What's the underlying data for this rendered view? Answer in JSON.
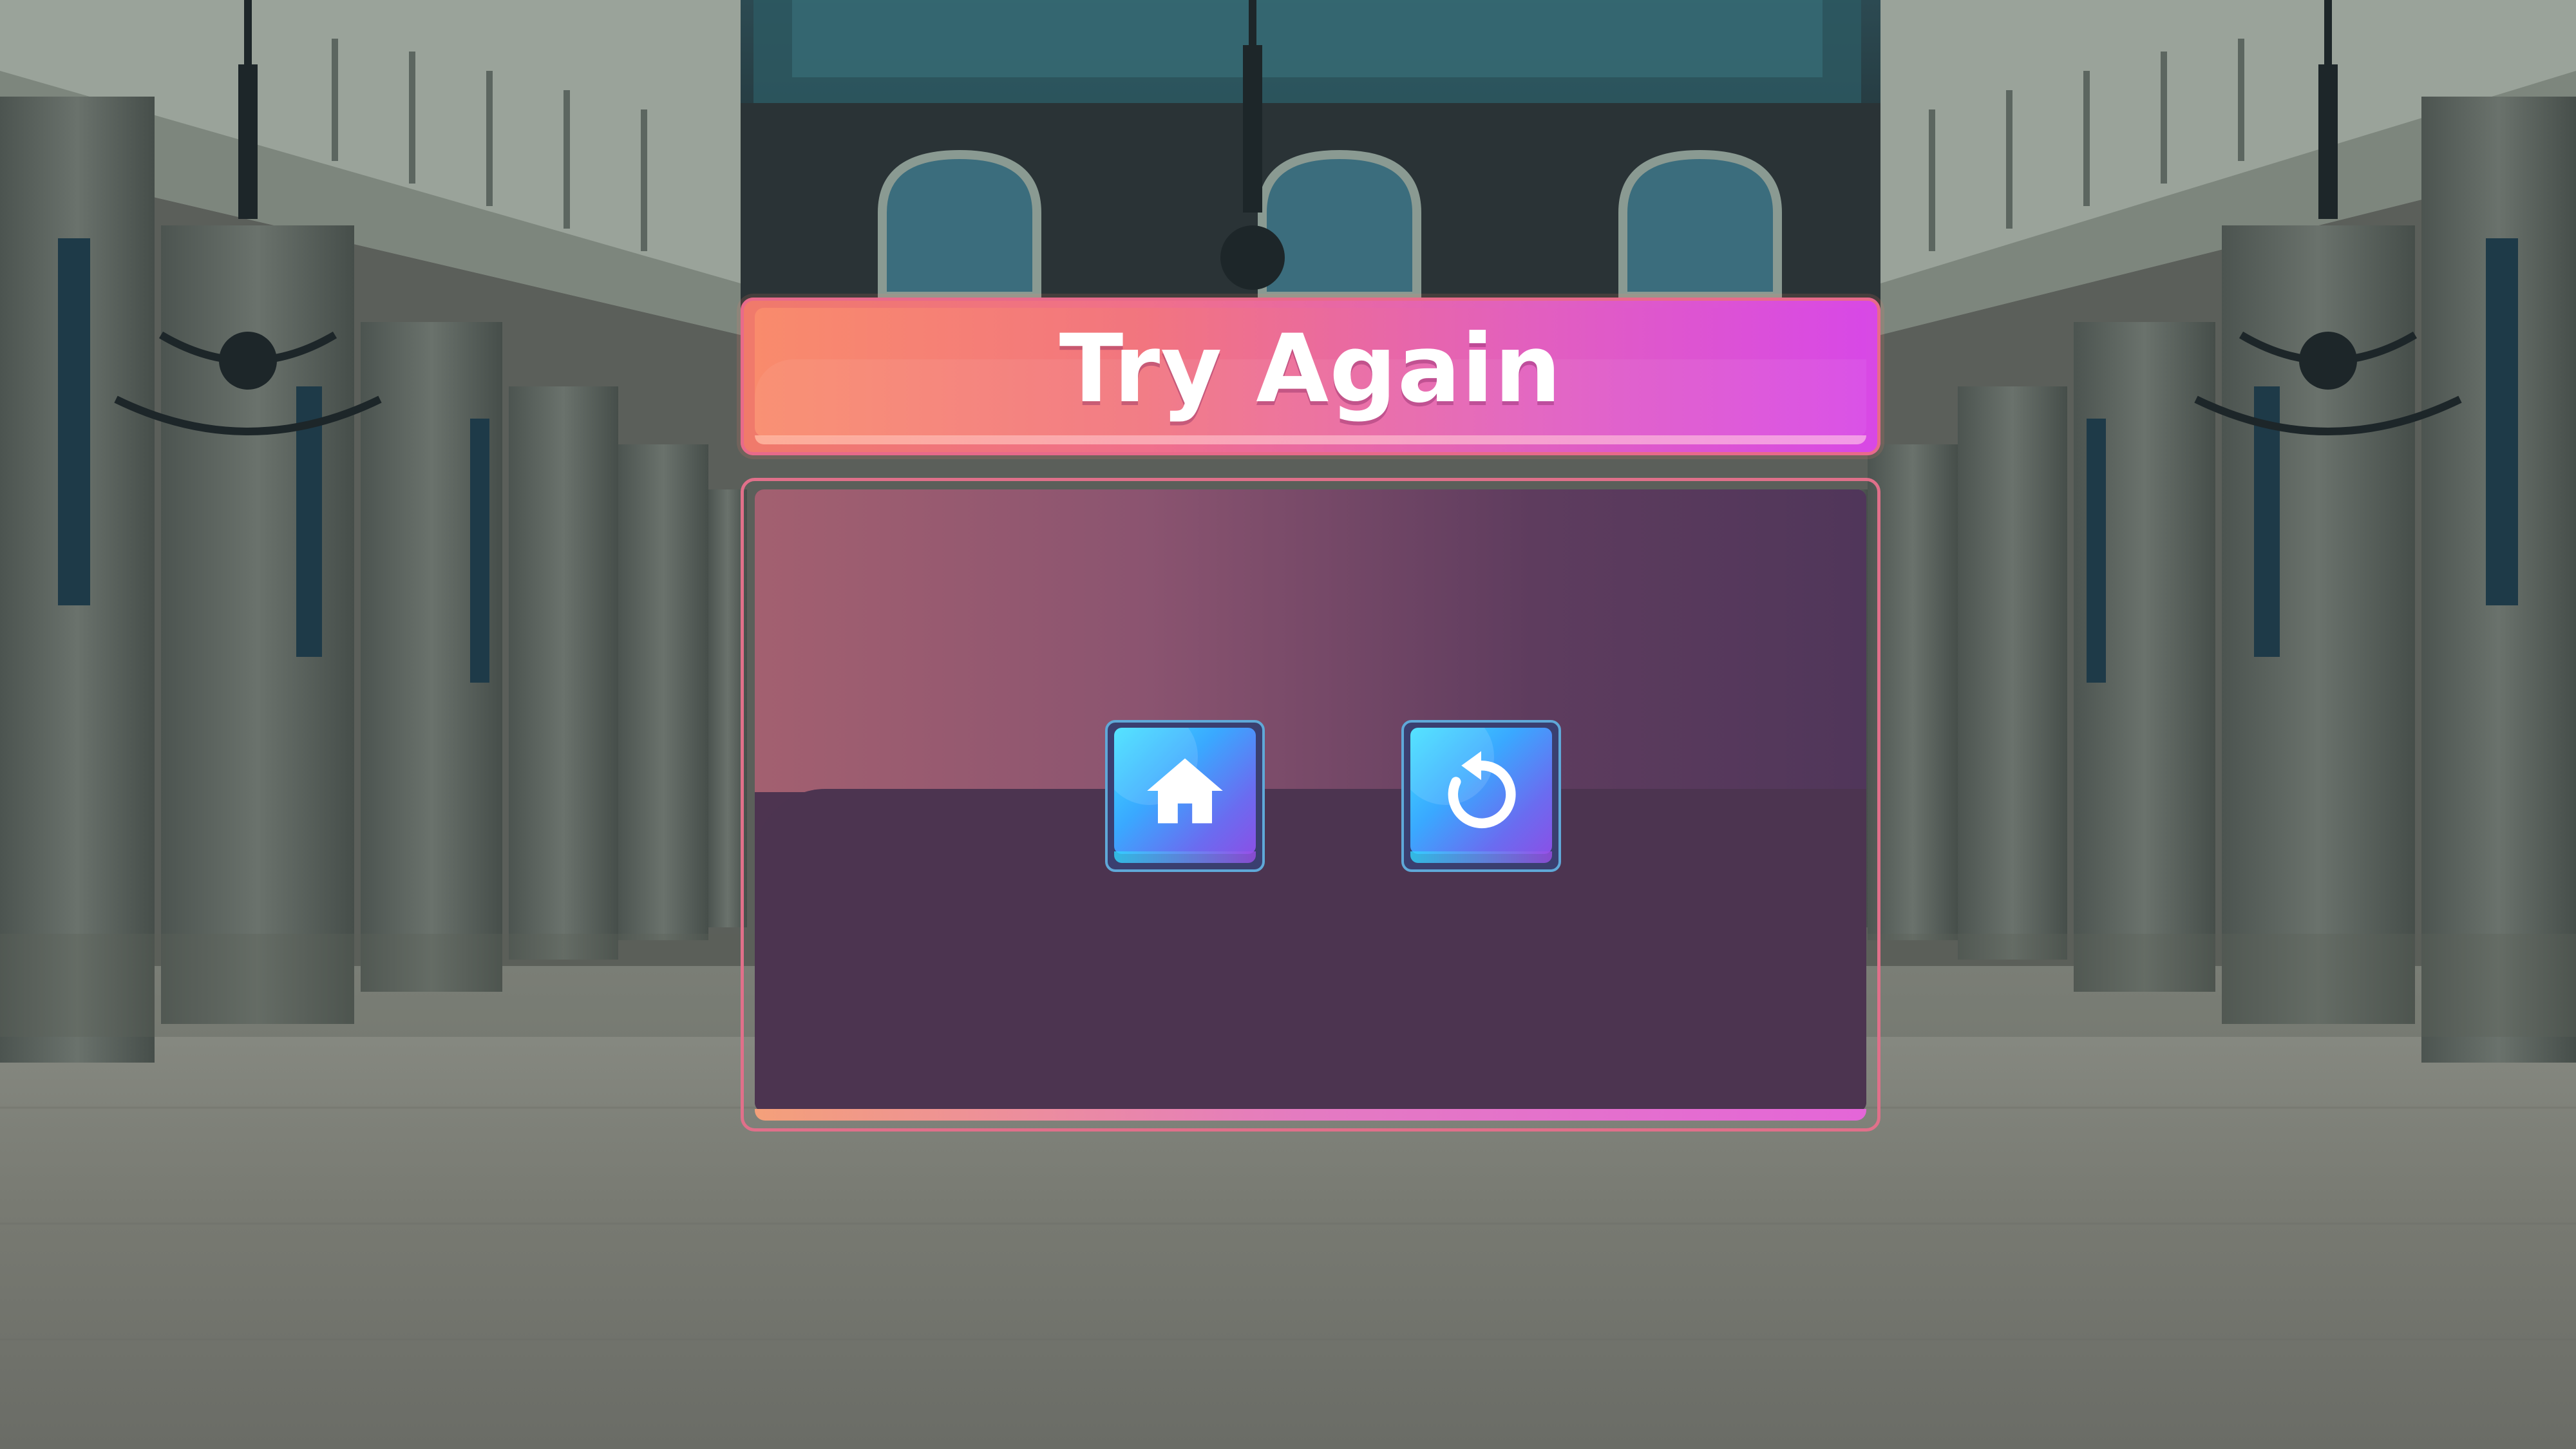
{
  "dialog": {
    "title": "Try Again"
  },
  "buttons": {
    "home": {
      "icon": "home-icon"
    },
    "replay": {
      "icon": "replay-icon"
    }
  },
  "colors": {
    "title_gradient_start": "#f98b6c",
    "title_gradient_end": "#d848e6",
    "panel_dark": "#4d3450",
    "panel_light": "#a36070",
    "button_cyan": "#3de0ff",
    "button_purple": "#8a50e6",
    "icon_white": "#ffffff"
  }
}
